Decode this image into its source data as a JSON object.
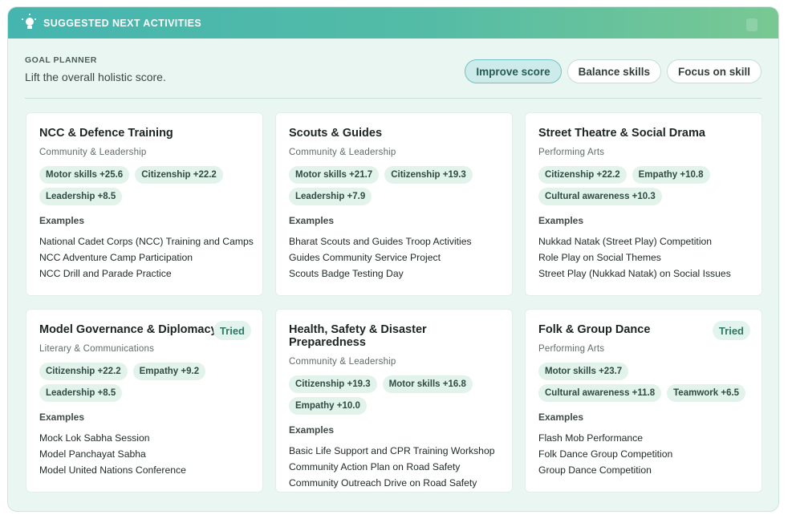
{
  "header": {
    "title": "SUGGESTED NEXT ACTIVITIES",
    "icon": "lightbulb-icon",
    "gradient": [
      "#45b5b0",
      "#79c893"
    ]
  },
  "planner": {
    "label": "GOAL PLANNER",
    "text": "Lift the overall holistic score."
  },
  "modes": [
    {
      "label": "Improve score",
      "active": true
    },
    {
      "label": "Balance skills",
      "active": false
    },
    {
      "label": "Focus on skill",
      "active": false
    }
  ],
  "examples_label": "Examples",
  "cards": [
    {
      "title": "NCC & Defence Training",
      "category": "Community & Leadership",
      "tried": "",
      "chips": [
        "Motor skills +25.6",
        "Citizenship +22.2",
        "Leadership +8.5"
      ],
      "examples": [
        "National Cadet Corps (NCC) Training and Camps",
        "NCC Adventure Camp Participation",
        "NCC Drill and Parade Practice"
      ]
    },
    {
      "title": "Scouts & Guides",
      "category": "Community & Leadership",
      "tried": "",
      "chips": [
        "Motor skills +21.7",
        "Citizenship +19.3",
        "Leadership +7.9"
      ],
      "examples": [
        "Bharat Scouts and Guides Troop Activities",
        "Guides Community Service Project",
        "Scouts Badge Testing Day"
      ]
    },
    {
      "title": "Street Theatre & Social Drama",
      "category": "Performing Arts",
      "tried": "",
      "chips": [
        "Citizenship +22.2",
        "Empathy +10.8",
        "Cultural awareness +10.3"
      ],
      "examples": [
        "Nukkad Natak (Street Play) Competition",
        "Role Play on Social Themes",
        "Street Play (Nukkad Natak) on Social Issues"
      ]
    },
    {
      "title": "Model Governance & Diplomacy",
      "category": "Literary & Communications",
      "tried": "Tried",
      "chips": [
        "Citizenship +22.2",
        "Empathy +9.2",
        "Leadership +8.5"
      ],
      "examples": [
        "Mock Lok Sabha Session",
        "Model Panchayat Sabha",
        "Model United Nations Conference"
      ]
    },
    {
      "title": "Health, Safety & Disaster Preparedness",
      "category": "Community & Leadership",
      "tried": "",
      "chips": [
        "Citizenship +19.3",
        "Motor skills +16.8",
        "Empathy +10.0"
      ],
      "examples": [
        "Basic Life Support and CPR Training Workshop",
        "Community Action Plan on Road Safety",
        "Community Outreach Drive on Road Safety"
      ]
    },
    {
      "title": "Folk & Group Dance",
      "category": "Performing Arts",
      "tried": "Tried",
      "chips": [
        "Motor skills +23.7",
        "Cultural awareness +11.8",
        "Teamwork +6.5"
      ],
      "examples": [
        "Flash Mob Performance",
        "Folk Dance Group Competition",
        "Group Dance Competition"
      ]
    }
  ]
}
